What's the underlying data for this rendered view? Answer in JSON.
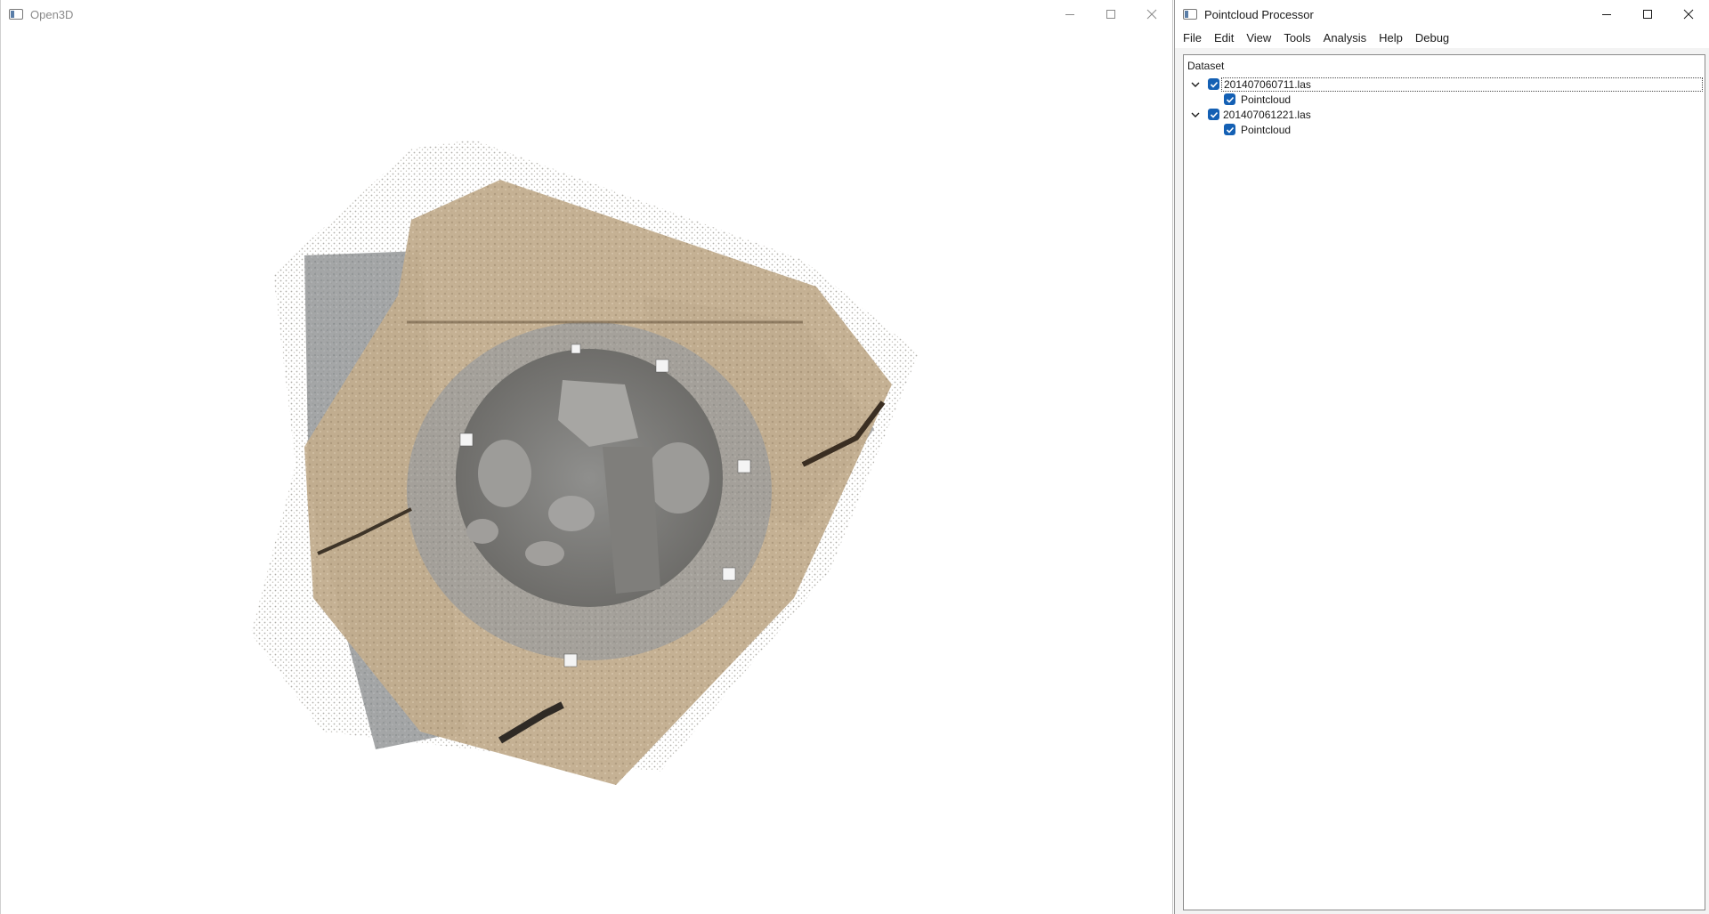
{
  "open3d": {
    "title": "Open3D",
    "icon": "app-window-icon",
    "viewport_content": "textured point cloud of excavation pit viewed from above"
  },
  "pcp": {
    "title": "Pointcloud Processor",
    "icon": "app-window-icon",
    "menu": [
      "File",
      "Edit",
      "View",
      "Tools",
      "Analysis",
      "Help",
      "Debug"
    ],
    "tree_header": "Dataset",
    "items": [
      {
        "label": "201407060711.las",
        "expanded": true,
        "checked": true,
        "selected": true,
        "children": [
          {
            "label": "Pointcloud",
            "checked": true
          }
        ]
      },
      {
        "label": "201407061221.las",
        "expanded": true,
        "checked": true,
        "selected": false,
        "children": [
          {
            "label": "Pointcloud",
            "checked": true
          }
        ]
      }
    ]
  },
  "colors": {
    "checkbox": "#1460b4",
    "soil": "#b8a487",
    "stone": "#8e9194"
  }
}
